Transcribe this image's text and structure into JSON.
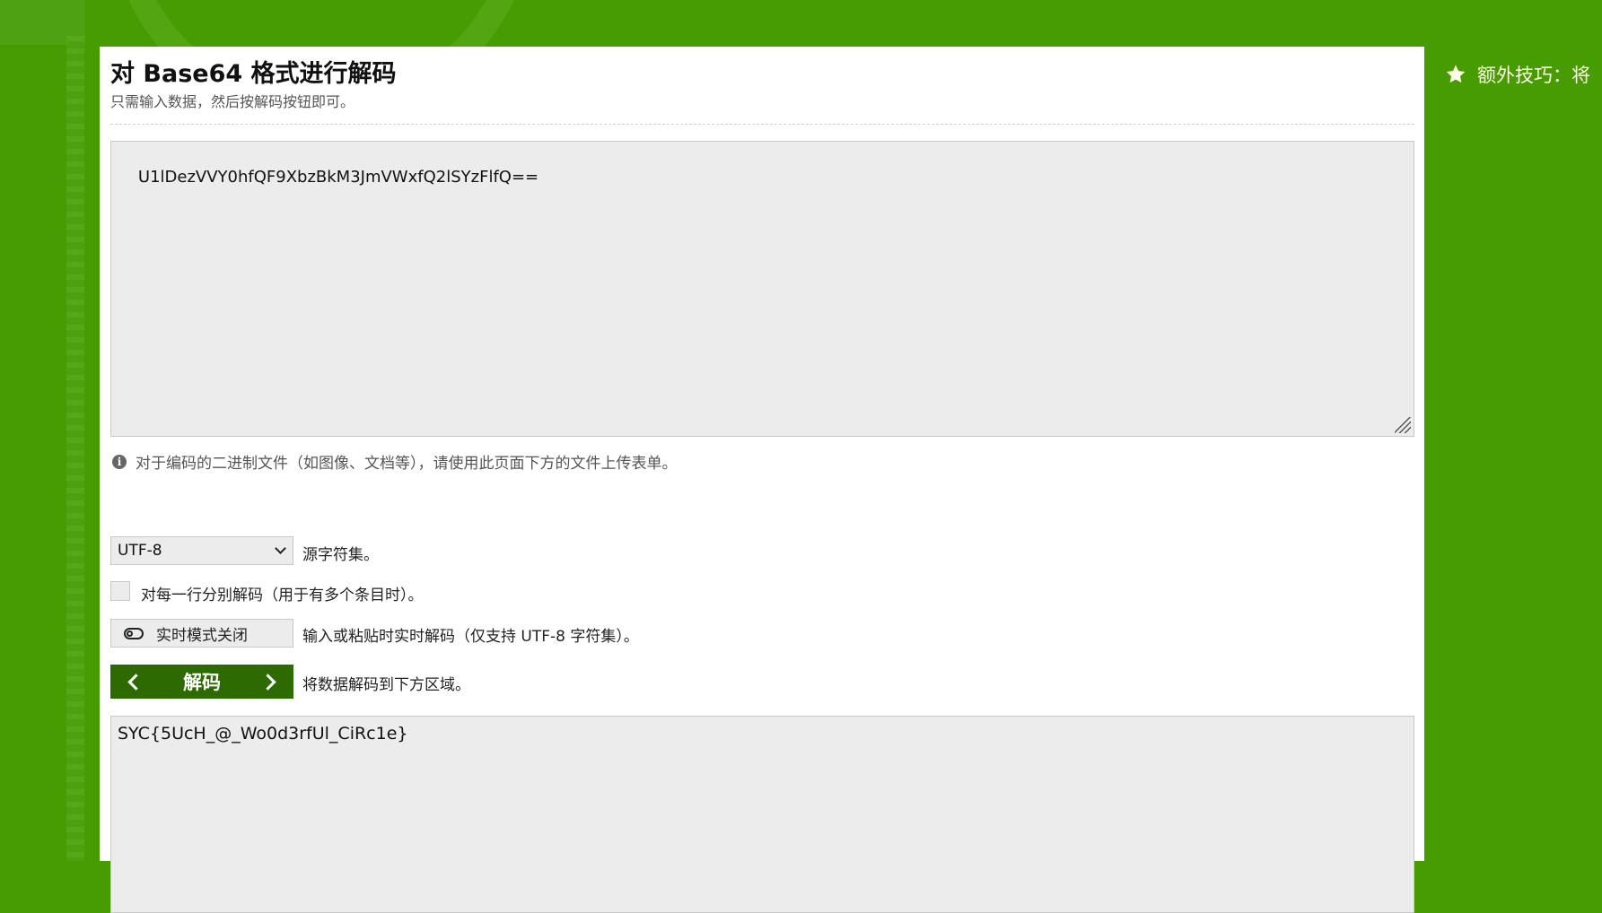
{
  "header": {
    "title": "对 Base64 格式进行解码",
    "subtitle": "只需输入数据，然后按解码按钮即可。"
  },
  "input": {
    "value": "U1lDezVVY0hfQF9XbzBkM3JmVWxfQ2lSYzFlfQ=="
  },
  "info": {
    "text": "对于编码的二进制文件（如图像、文档等），请使用此页面下方的文件上传表单。"
  },
  "charset": {
    "selected": "UTF-8",
    "label": "源字符集。"
  },
  "line_by_line": {
    "label": "对每一行分别解码（用于有多个条目时）。"
  },
  "live_mode": {
    "button_label": "实时模式关闭",
    "label": "输入或粘贴时实时解码（仅支持 UTF-8 字符集）。"
  },
  "decode": {
    "button_label": "解码",
    "label": "将数据解码到下方区域。"
  },
  "output": {
    "value": "SYC{5UcH_@_Wo0d3rfUl_CiRc1e}"
  },
  "sidebar": {
    "tip": "额外技巧：将"
  },
  "colors": {
    "background": "#469c00",
    "button": "#2d6b00"
  }
}
